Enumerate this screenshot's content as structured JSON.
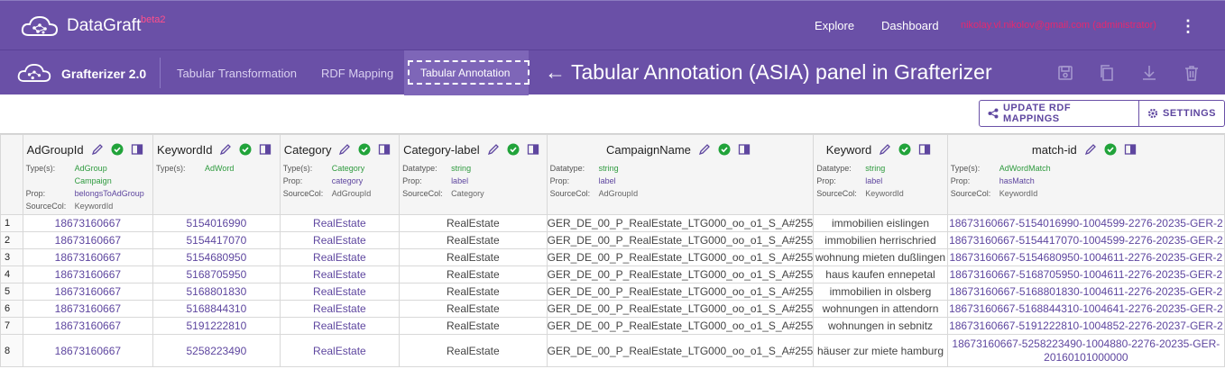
{
  "app": {
    "brand": "DataGraft",
    "beta": "beta2",
    "nav": [
      "Explore",
      "Dashboard"
    ],
    "user_email": "nikolay.vl.nikolov@gmail.com (administrator)"
  },
  "subbar": {
    "title": "Grafterizer 2.0",
    "tabs": [
      "Tabular Transformation",
      "RDF Mapping",
      "Tabular Annotation"
    ],
    "active_tab": "Tabular Annotation",
    "annotation": "← Tabular Annotation (ASIA) panel in Grafterizer",
    "tools": [
      "save-icon",
      "copy-icon",
      "download-icon",
      "delete-icon"
    ]
  },
  "actions": {
    "update_label": "UPDATE RDF MAPPINGS",
    "settings_label": "SETTINGS"
  },
  "columns": [
    {
      "name": "AdGroupId",
      "l1": "Type(s):",
      "v1": "AdGroup",
      "v1b": "Campaign",
      "l2": "Prop:",
      "v2": "belongsToAdGroup",
      "l3": "SourceCol:",
      "v3": "KeywordId"
    },
    {
      "name": "KeywordId",
      "l1": "Type(s):",
      "v1": "AdWord",
      "v1b": "",
      "l2": "",
      "v2": "",
      "l3": "",
      "v3": ""
    },
    {
      "name": "Category",
      "l1": "Type(s):",
      "v1": "Category",
      "v1b": "",
      "l2": "Prop:",
      "v2": "category",
      "l3": "SourceCol:",
      "v3": "AdGroupId"
    },
    {
      "name": "Category-label",
      "l1": "Datatype:",
      "v1": "string",
      "v1b": "",
      "l2": "Prop:",
      "v2": "label",
      "l3": "SourceCol:",
      "v3": "Category"
    },
    {
      "name": "CampaignName",
      "l1": "Datatype:",
      "v1": "string",
      "v1b": "",
      "l2": "Prop:",
      "v2": "label",
      "l3": "SourceCol:",
      "v3": "AdGroupId"
    },
    {
      "name": "Keyword",
      "l1": "Datatype:",
      "v1": "string",
      "v1b": "",
      "l2": "Prop:",
      "v2": "label",
      "l3": "SourceCol:",
      "v3": "KeywordId"
    },
    {
      "name": "match-id",
      "l1": "Type(s):",
      "v1": "AdWordMatch",
      "v1b": "",
      "l2": "Prop:",
      "v2": "hasMatch",
      "l3": "SourceCol:",
      "v3": "KeywordId"
    }
  ],
  "rows": [
    {
      "n": "1",
      "c": [
        "18673160667",
        "5154016990",
        "RealEstate",
        "RealEstate",
        "GER_DE_00_P_RealEstate_LTG000_oo_o1_S_A#255",
        "immobilien eislingen",
        "18673160667-5154016990-1004599-2276-20235-GER-2"
      ]
    },
    {
      "n": "2",
      "c": [
        "18673160667",
        "5154417070",
        "RealEstate",
        "RealEstate",
        "GER_DE_00_P_RealEstate_LTG000_oo_o1_S_A#255",
        "immobilien herrischried",
        "18673160667-5154417070-1004599-2276-20235-GER-2"
      ]
    },
    {
      "n": "3",
      "c": [
        "18673160667",
        "5154680950",
        "RealEstate",
        "RealEstate",
        "GER_DE_00_P_RealEstate_LTG000_oo_o1_S_A#255",
        "wohnung mieten dußlingen",
        "18673160667-5154680950-1004611-2276-20235-GER-2"
      ]
    },
    {
      "n": "4",
      "c": [
        "18673160667",
        "5168705950",
        "RealEstate",
        "RealEstate",
        "GER_DE_00_P_RealEstate_LTG000_oo_o1_S_A#255",
        "haus kaufen ennepetal",
        "18673160667-5168705950-1004611-2276-20235-GER-2"
      ]
    },
    {
      "n": "5",
      "c": [
        "18673160667",
        "5168801830",
        "RealEstate",
        "RealEstate",
        "GER_DE_00_P_RealEstate_LTG000_oo_o1_S_A#255",
        "immobilien in olsberg",
        "18673160667-5168801830-1004611-2276-20235-GER-2"
      ]
    },
    {
      "n": "6",
      "c": [
        "18673160667",
        "5168844310",
        "RealEstate",
        "RealEstate",
        "GER_DE_00_P_RealEstate_LTG000_oo_o1_S_A#255",
        "wohnungen in attendorn",
        "18673160667-5168844310-1004641-2276-20235-GER-2"
      ]
    },
    {
      "n": "7",
      "c": [
        "18673160667",
        "5191222810",
        "RealEstate",
        "RealEstate",
        "GER_DE_00_P_RealEstate_LTG000_oo_o1_S_A#255",
        "wohnungen in sebnitz",
        "18673160667-5191222810-1004852-2276-20237-GER-2"
      ]
    },
    {
      "n": "8",
      "c": [
        "18673160667",
        "5258223490",
        "RealEstate",
        "RealEstate",
        "GER_DE_00_P_RealEstate_LTG000_oo_o1_S_A#255",
        "häuser zur miete hamburg",
        "18673160667-5258223490-1004880-2276-20235-GER-20160101000000"
      ]
    }
  ],
  "colors": {
    "header_bg": "#6a50a7",
    "accent": "#5e469f",
    "check_green": "#21a33a",
    "link_purple": "#5e469f"
  }
}
